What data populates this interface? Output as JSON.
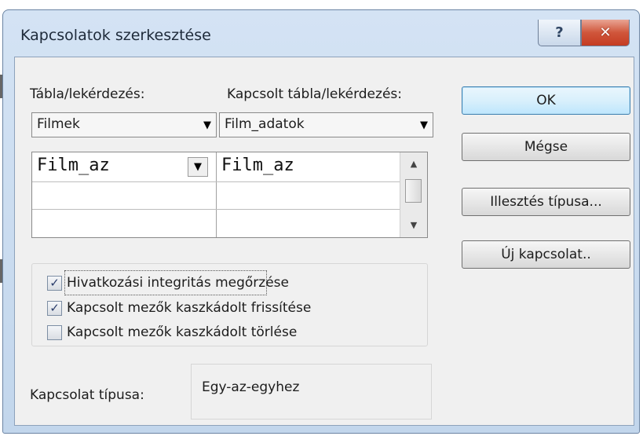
{
  "window": {
    "title": "Kapcsolatok szerkesztése",
    "help_glyph": "?",
    "close_glyph": "✕"
  },
  "table": {
    "label": "Tábla/lekérdezés:",
    "value": "Filmek"
  },
  "related_table": {
    "label": "Kapcsolt tábla/lekérdezés:",
    "value": "Film_adatok"
  },
  "fields": {
    "rows": [
      {
        "left": "Film_az",
        "right": "Film_az"
      },
      {
        "left": "",
        "right": ""
      },
      {
        "left": "",
        "right": ""
      }
    ]
  },
  "options": [
    {
      "label": "Hivatkozási integritás megőrzése",
      "checked": true
    },
    {
      "label": "Kapcsolt mezők kaszkádolt frissítése",
      "checked": true
    },
    {
      "label": "Kapcsolt mezők kaszkádolt törlése",
      "checked": false
    }
  ],
  "relationship": {
    "label": "Kapcsolat típusa:",
    "value": "Egy-az-egyhez"
  },
  "buttons": {
    "ok": "OK",
    "cancel": "Mégse",
    "join_type": "Illesztés típusa...",
    "new_relationship": "Új kapcsolat.."
  },
  "glyphs": {
    "down_arrow": "▼",
    "scroll_up": "▲",
    "scroll_down": "▼",
    "check": "✓"
  }
}
